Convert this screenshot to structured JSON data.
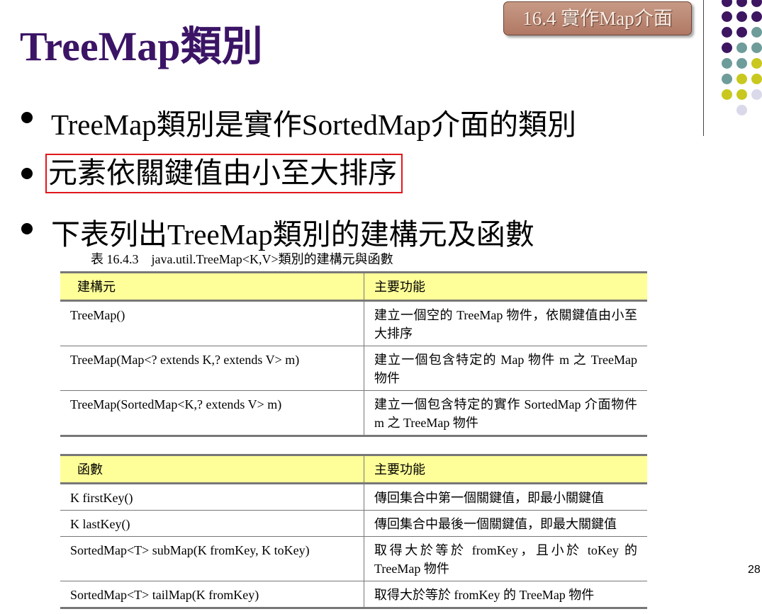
{
  "title": "TreeMap類別",
  "section_tab": "16.4 實作Map介面",
  "bullets": [
    "TreeMap類別是實作SortedMap介面的類別",
    "元素依關鍵值由小至大排序",
    "下表列出TreeMap類別的建構元及函數"
  ],
  "table_caption": "表 16.4.3　java.util.TreeMap<K,V>類別的建構元與函數",
  "constructors_table": {
    "headers": [
      "建構元",
      "主要功能"
    ],
    "rows": [
      [
        "TreeMap()",
        "建立一個空的 TreeMap 物件，依關鍵值由小至大排序"
      ],
      [
        "TreeMap(Map<? extends K,? extends V> m)",
        "建立一個包含特定的 Map 物件 m 之 TreeMap 物件"
      ],
      [
        "TreeMap(SortedMap<K,? extends V> m)",
        "建立一個包含特定的實作 SortedMap 介面物件 m 之 TreeMap 物件"
      ]
    ]
  },
  "methods_table": {
    "headers": [
      "函數",
      "主要功能"
    ],
    "rows": [
      [
        "K firstKey()",
        "傳回集合中第一個關鍵值，即最小關鍵值"
      ],
      [
        "K lastKey()",
        "傳回集合中最後一個關鍵值，即最大關鍵值"
      ],
      [
        "SortedMap<T> subMap(K fromKey, K toKey)",
        "取得大於等於 fromKey，且小於 toKey 的 TreeMap 物件"
      ],
      [
        "SortedMap<T> tailMap(K fromKey)",
        "取得大於等於 fromKey 的 TreeMap 物件"
      ]
    ]
  },
  "page_number": "28",
  "colors": {
    "title": "#3b1466",
    "dot_purple": "#3d1560",
    "dot_teal": "#6e9c9b",
    "dot_olive": "#c8c81e",
    "dot_lavender": "#d9d9ea",
    "table_header": "#ffff99",
    "highlight_border": "#e2171d"
  }
}
